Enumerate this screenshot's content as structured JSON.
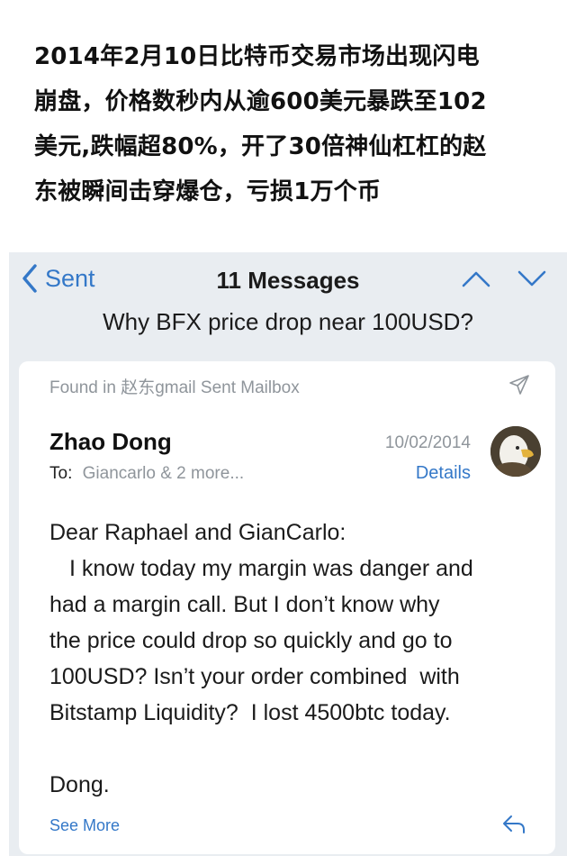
{
  "caption": {
    "lines": [
      "2014年2月10日比特币交易市场出现闪电",
      "崩盘，价格数秒内从逾600美元暴跌至102",
      "美元,跌幅超80%，开了30倍神仙杠杠的赵",
      "东被瞬间击穿爆仓，亏损1万个币"
    ]
  },
  "nav": {
    "back_label": "Sent",
    "message_count": "11 Messages",
    "subject": "Why BFX price drop near 100USD?"
  },
  "mail": {
    "found_in": "Found in 赵东gmail Sent Mailbox",
    "sender": "Zhao Dong",
    "date": "10/02/2014",
    "to_label": "To:",
    "to_value": "Giancarlo & 2 more...",
    "details_label": "Details",
    "body": {
      "greeting": "Dear Raphael and GianCarlo:",
      "lines": [
        "I know today my margin was danger and",
        "had a margin call. But I don’t know why",
        "the price could drop so quickly and go to",
        "100USD? Isn’t your order combined  with",
        "Bitstamp Liquidity?  I lost 4500btc today."
      ],
      "signature": "Dong."
    },
    "see_more_label": "See More"
  },
  "icons": {
    "back": "chevron-left-icon",
    "prev": "chevron-up-icon",
    "next": "chevron-down-icon",
    "sent": "paper-plane-icon",
    "reply": "reply-arrow-icon",
    "avatar": "eagle-avatar"
  },
  "colors": {
    "accent": "#3478c8",
    "muted": "#8f959b",
    "phone_bg": "#e9edf1"
  }
}
